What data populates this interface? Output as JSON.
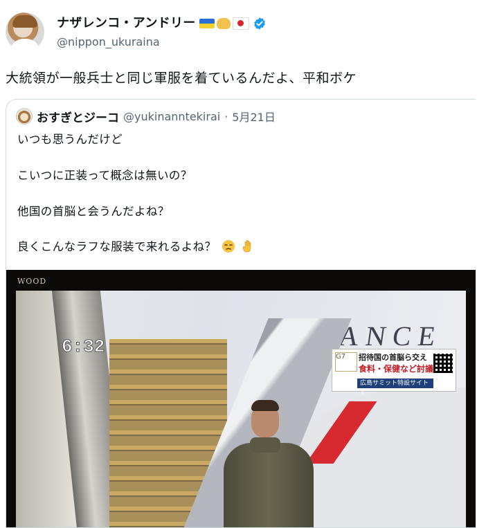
{
  "author": {
    "display_name": "ナザレンコ・アンドリー",
    "handle": "@nippon_ukuraina",
    "emoji_icons": [
      "ukraine-flag-icon",
      "handshake-icon",
      "japan-flag-icon"
    ],
    "verified_icon": "verified-badge-icon"
  },
  "tweet": {
    "text": "大統領が一般兵士と同じ軍服を着ているんだよ、平和ボケ"
  },
  "quoted_tweet": {
    "display_name": "おすぎとジーコ",
    "handle": "@yukinanntekirai",
    "separator": "·",
    "date": "5月21日",
    "lines": [
      "いつも思うんだけど",
      "こいつに正装って概念は無いの？",
      "他国の首脳と会うんだよね？",
      "良くこんなラフな服装で来れるよね？"
    ],
    "line4_emoji_icons": [
      "unamused-face-icon",
      "raised-hand-icon"
    ],
    "media": {
      "tv_brand": "WOOD",
      "clock": "6:32",
      "plane_text": "RANCE",
      "news_header": "招待国の首脳ら交え",
      "news_topic": "食料・保健など討議",
      "news_bar": "広島サミット特設サイト↑",
      "summit_logo": "G7"
    }
  },
  "colors": {
    "text": "#0f1419",
    "secondary": "#536471",
    "border": "#cfd9de",
    "verified": "#1d9bf0"
  }
}
